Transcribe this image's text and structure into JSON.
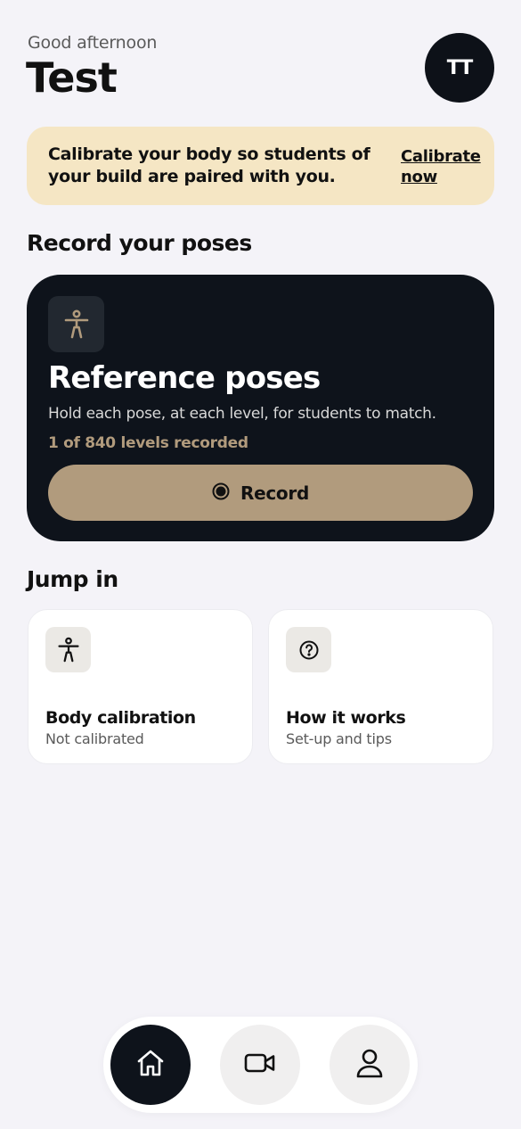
{
  "header": {
    "greeting": "Good afternoon",
    "user_name": "Test",
    "avatar_initials": "TT"
  },
  "banner": {
    "message": "Calibrate your body so students of your build are paired with you.",
    "link_label": "Calibrate now",
    "background_color": "#f5e6c4"
  },
  "record_section": {
    "title": "Record your poses",
    "card": {
      "title": "Reference poses",
      "description": "Hold each pose, at each level, for students to match.",
      "progress_text": "1 of 840 levels recorded",
      "progress_value": 0.00119,
      "icon": "person-pose-icon",
      "button_label": "Record",
      "button_icon": "record-dot-icon",
      "background_color": "#0e131b",
      "accent_color": "#b19b7d"
    }
  },
  "jump_section": {
    "title": "Jump in",
    "tiles": [
      {
        "title": "Body calibration",
        "subtitle": "Not calibrated",
        "icon": "person-pose-icon"
      },
      {
        "title": "How it works",
        "subtitle": "Set-up and tips",
        "icon": "question-circle-icon"
      }
    ]
  },
  "tabbar": {
    "items": [
      {
        "icon": "home-icon",
        "active": true
      },
      {
        "icon": "video-camera-icon",
        "active": false
      },
      {
        "icon": "user-icon",
        "active": false
      }
    ]
  }
}
